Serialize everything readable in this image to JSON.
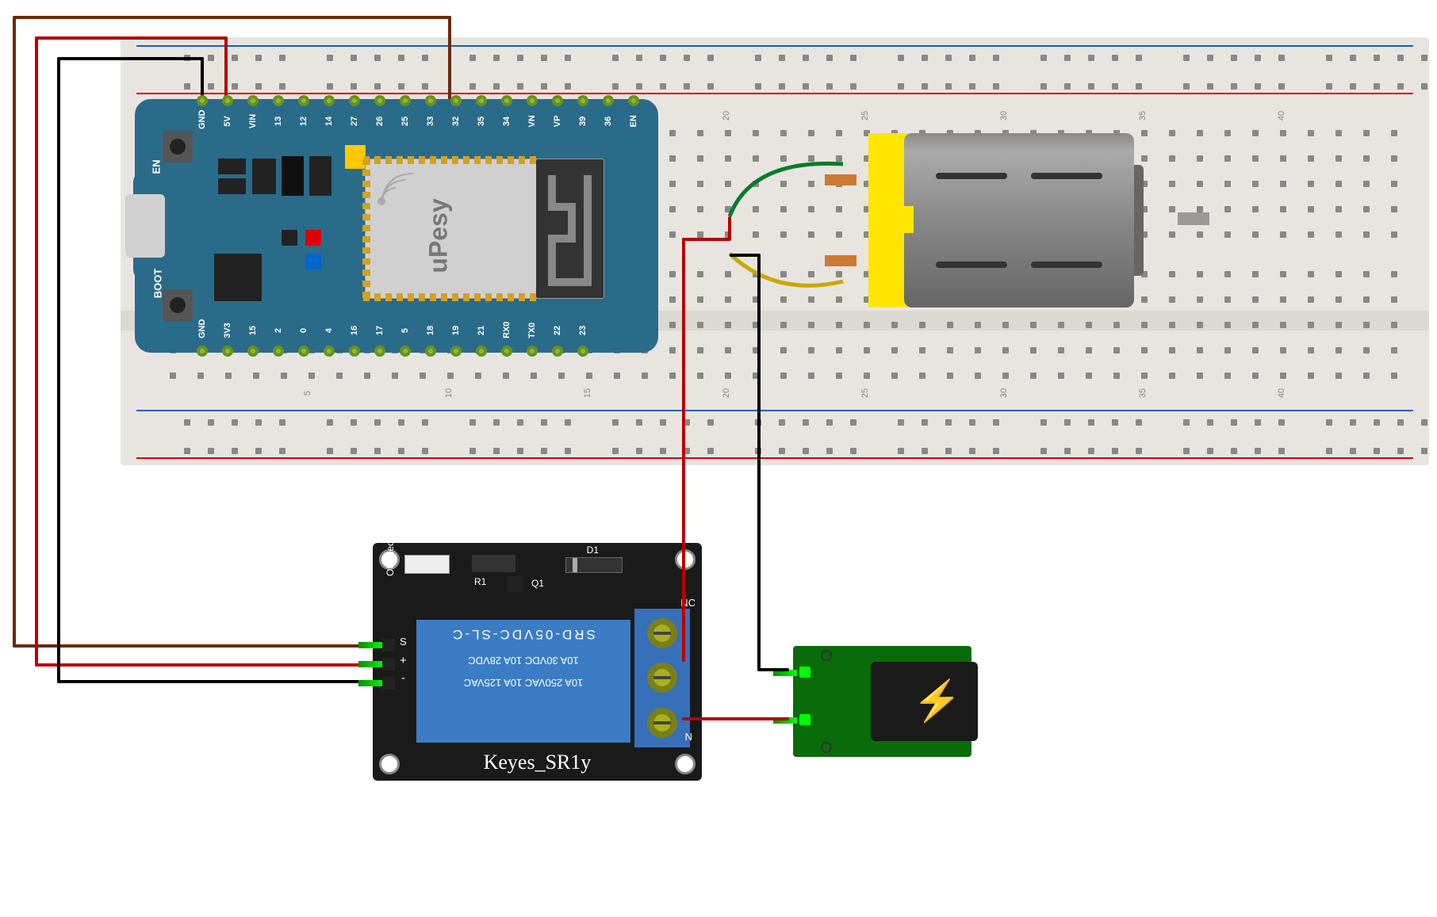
{
  "diagram": {
    "esp32": {
      "brand": "uPesy",
      "buttons": {
        "en": "EN",
        "boot": "BOOT"
      },
      "pins_top": [
        "GND",
        "5V",
        "VIN",
        "13",
        "12",
        "14",
        "27",
        "26",
        "25",
        "33",
        "32",
        "35",
        "34",
        "VN",
        "VP",
        "39",
        "36",
        "EN"
      ],
      "pins_bottom": [
        "GND",
        "3V3",
        "15",
        "2",
        "0",
        "4",
        "16",
        "17",
        "5",
        "18",
        "19",
        "21",
        "RX0",
        "TX0",
        "22",
        "23"
      ]
    },
    "relay": {
      "title": "Keyes_SR1y",
      "part_number": "SRD-05VDC-SL-C",
      "ratings_line1": "10A 250VAC  10A 125VAC",
      "ratings_line2": "10A 30VDC  10A 28VDC",
      "input_pins": [
        "S",
        "+",
        "-"
      ],
      "output_pins": [
        "NC",
        "",
        "N"
      ],
      "silkscreen": {
        "led": "ON_Led",
        "r1": "R1",
        "q1": "Q1",
        "d1": "D1"
      }
    },
    "motor": {
      "type": "DC Motor"
    },
    "power": {
      "type": "DC Barrel Jack"
    },
    "wires": [
      {
        "from": "ESP32 GND",
        "to": "Relay -",
        "color": "black"
      },
      {
        "from": "ESP32 5V",
        "to": "Relay +",
        "color": "red"
      },
      {
        "from": "ESP32 GPIO32",
        "to": "Relay S",
        "color": "brown"
      },
      {
        "from": "Relay COM",
        "to": "Motor term1",
        "color": "red"
      },
      {
        "from": "Relay N",
        "to": "Power +",
        "color": "red"
      },
      {
        "from": "Power -",
        "to": "Motor term2",
        "color": "black"
      },
      {
        "from": "Motor term1",
        "to": "breadboard",
        "color": "green"
      },
      {
        "from": "Motor term2",
        "to": "breadboard",
        "color": "yellow"
      }
    ]
  }
}
